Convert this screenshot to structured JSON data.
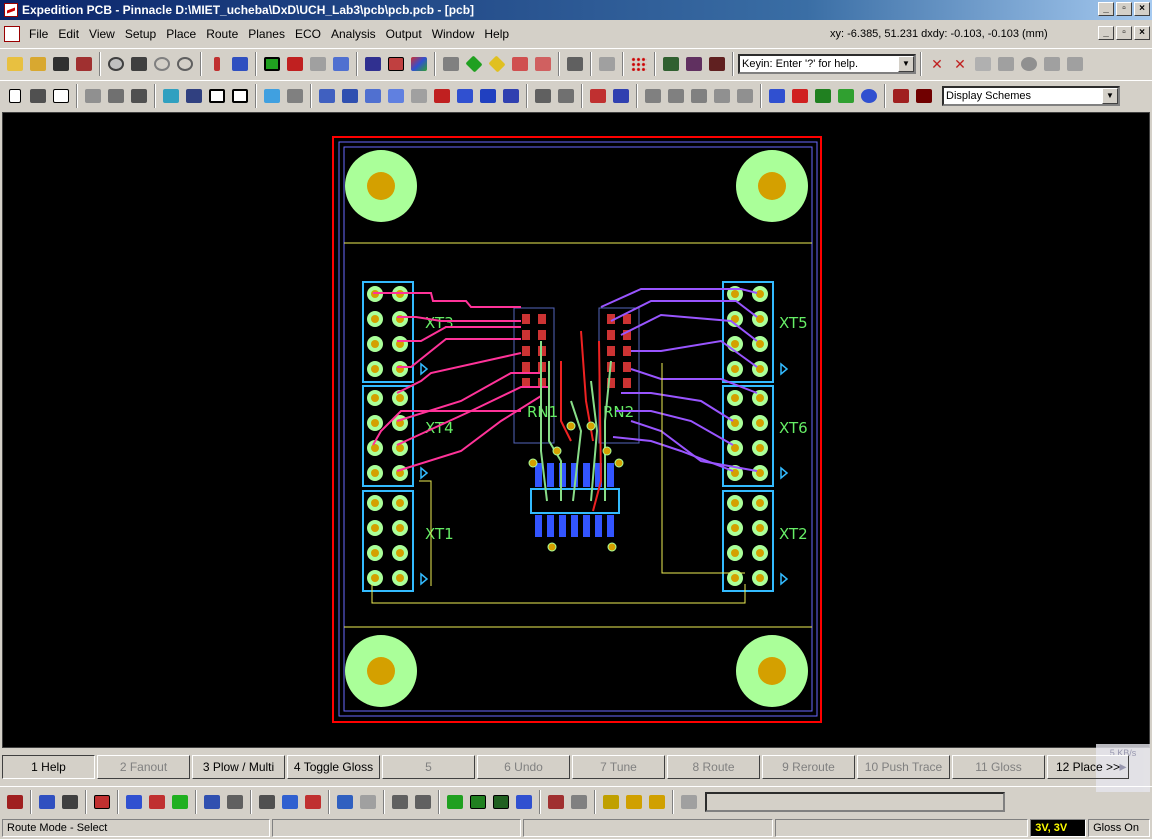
{
  "window": {
    "title": "Expedition PCB - Pinnacle  D:\\MIET_ucheba\\DxD\\UCH_Lab3\\pcb\\pcb.pcb - [pcb]"
  },
  "menu": [
    "File",
    "Edit",
    "View",
    "Setup",
    "Place",
    "Route",
    "Planes",
    "ECO",
    "Analysis",
    "Output",
    "Window",
    "Help"
  ],
  "coords": {
    "text": "xy: -6.385, 51.231   dxdy: -0.103, -0.103   (mm)"
  },
  "keyin": {
    "value": "Keyin: Enter '?' for help."
  },
  "display_schemes": {
    "value": "Display Schemes"
  },
  "board": {
    "components": [
      "XT3",
      "XT4",
      "XT1",
      "XT5",
      "XT6",
      "XT2",
      "RN1",
      "RN2"
    ],
    "colors": {
      "outline": "#ff0000",
      "board_edge": "#6a6aff",
      "pad_large": "#aaff99",
      "pad_inner": "#d4a000",
      "connector": "#33bbff",
      "trace_top": "#ff3399",
      "trace_bottom": "#9955ff",
      "trace_green": "#88dd88",
      "silkscreen": "#eeee55",
      "text": "#66ee66"
    }
  },
  "fkeys": [
    "1 Help",
    "2 Fanout",
    "3 Plow / Multi",
    "4 Toggle Gloss",
    "5",
    "6 Undo",
    "7 Tune",
    "8 Route",
    "9 Reroute",
    "10 Push Trace",
    "11 Gloss",
    "12 Place >>"
  ],
  "netmon": {
    "rate": "5 KB/s"
  },
  "status": {
    "mode": "Route Mode - Select",
    "layers": "3V, 3V",
    "gloss": "Gloss On"
  }
}
